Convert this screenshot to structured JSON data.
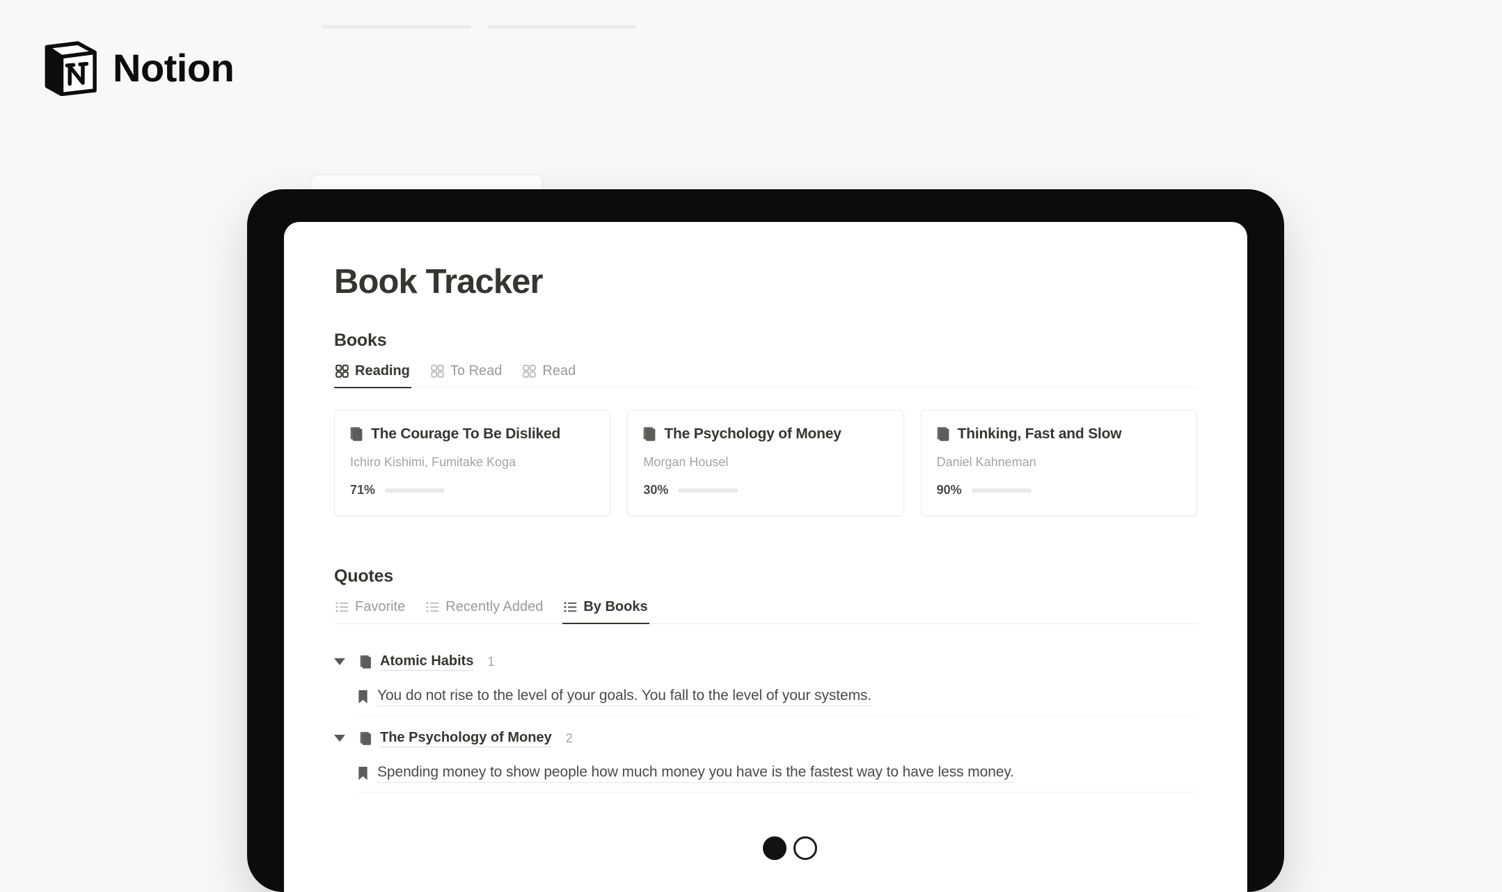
{
  "brand": {
    "name": "Notion",
    "logo_icon": "notion-logo-icon"
  },
  "device": {
    "type": "tablet"
  },
  "page": {
    "title": "Book Tracker"
  },
  "books_section": {
    "heading": "Books",
    "tabs": [
      {
        "label": "Reading",
        "icon": "gallery-view-icon",
        "active": true
      },
      {
        "label": "To Read",
        "icon": "gallery-view-icon",
        "active": false
      },
      {
        "label": "Read",
        "icon": "gallery-view-icon",
        "active": false
      }
    ],
    "cards": [
      {
        "title": "The Courage To Be Disliked",
        "author": "Ichiro Kishimi, Fumitake Koga",
        "progress_label": "71%",
        "progress_value": 71,
        "icon": "book-page-icon"
      },
      {
        "title": "The Psychology of Money",
        "author": "Morgan Housel",
        "progress_label": "30%",
        "progress_value": 30,
        "icon": "book-page-icon"
      },
      {
        "title": "Thinking, Fast and Slow",
        "author": "Daniel Kahneman",
        "progress_label": "90%",
        "progress_value": 90,
        "icon": "book-page-icon"
      }
    ]
  },
  "quotes_section": {
    "heading": "Quotes",
    "tabs": [
      {
        "label": "Favorite",
        "icon": "list-view-icon",
        "active": false
      },
      {
        "label": "Recently Added",
        "icon": "list-view-icon",
        "active": false
      },
      {
        "label": "By Books",
        "icon": "list-view-icon",
        "active": true
      }
    ],
    "groups": [
      {
        "name": "Atomic Habits",
        "count": "1",
        "icon": "book-page-icon",
        "toggle_icon": "triangle-down-icon",
        "quotes": [
          {
            "text": "You do not rise to the level of your goals. You fall to the level of your systems.",
            "icon": "bookmark-icon"
          }
        ]
      },
      {
        "name": "The Psychology of Money",
        "count": "2",
        "icon": "book-page-icon",
        "toggle_icon": "triangle-down-icon",
        "quotes": [
          {
            "text": "Spending money to show people how much money you have is the fastest way to have less money.",
            "icon": "bookmark-icon"
          }
        ]
      }
    ]
  },
  "colors": {
    "background": "#f8f8f8",
    "text_primary": "#37352f",
    "text_secondary": "#9b9a97",
    "device_bezel": "#0c0c0c",
    "progress_fill": "#b6b5b2"
  }
}
